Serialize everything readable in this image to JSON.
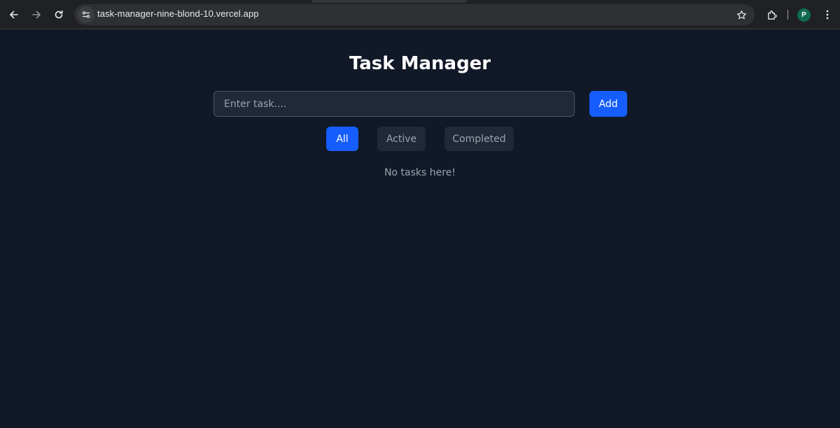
{
  "browser": {
    "url": "task-manager-nine-blond-10.vercel.app",
    "avatar_initial": "P",
    "icons": {
      "back": "arrow-left-icon",
      "forward": "arrow-right-icon",
      "reload": "reload-icon",
      "site_info": "site-settings-icon",
      "bookmark": "star-icon",
      "extensions": "puzzle-icon",
      "menu": "kebab-menu-icon"
    }
  },
  "app": {
    "title": "Task Manager",
    "input": {
      "placeholder": "Enter task....",
      "value": ""
    },
    "add_label": "Add",
    "filters": [
      {
        "label": "All",
        "selected": true
      },
      {
        "label": "Active",
        "selected": false
      },
      {
        "label": "Completed",
        "selected": false
      }
    ],
    "empty_message": "No tasks here!"
  },
  "colors": {
    "page_bg": "#111827",
    "accent": "#155dfc",
    "input_bg": "#1f2937",
    "muted_text": "#9ca3af"
  }
}
